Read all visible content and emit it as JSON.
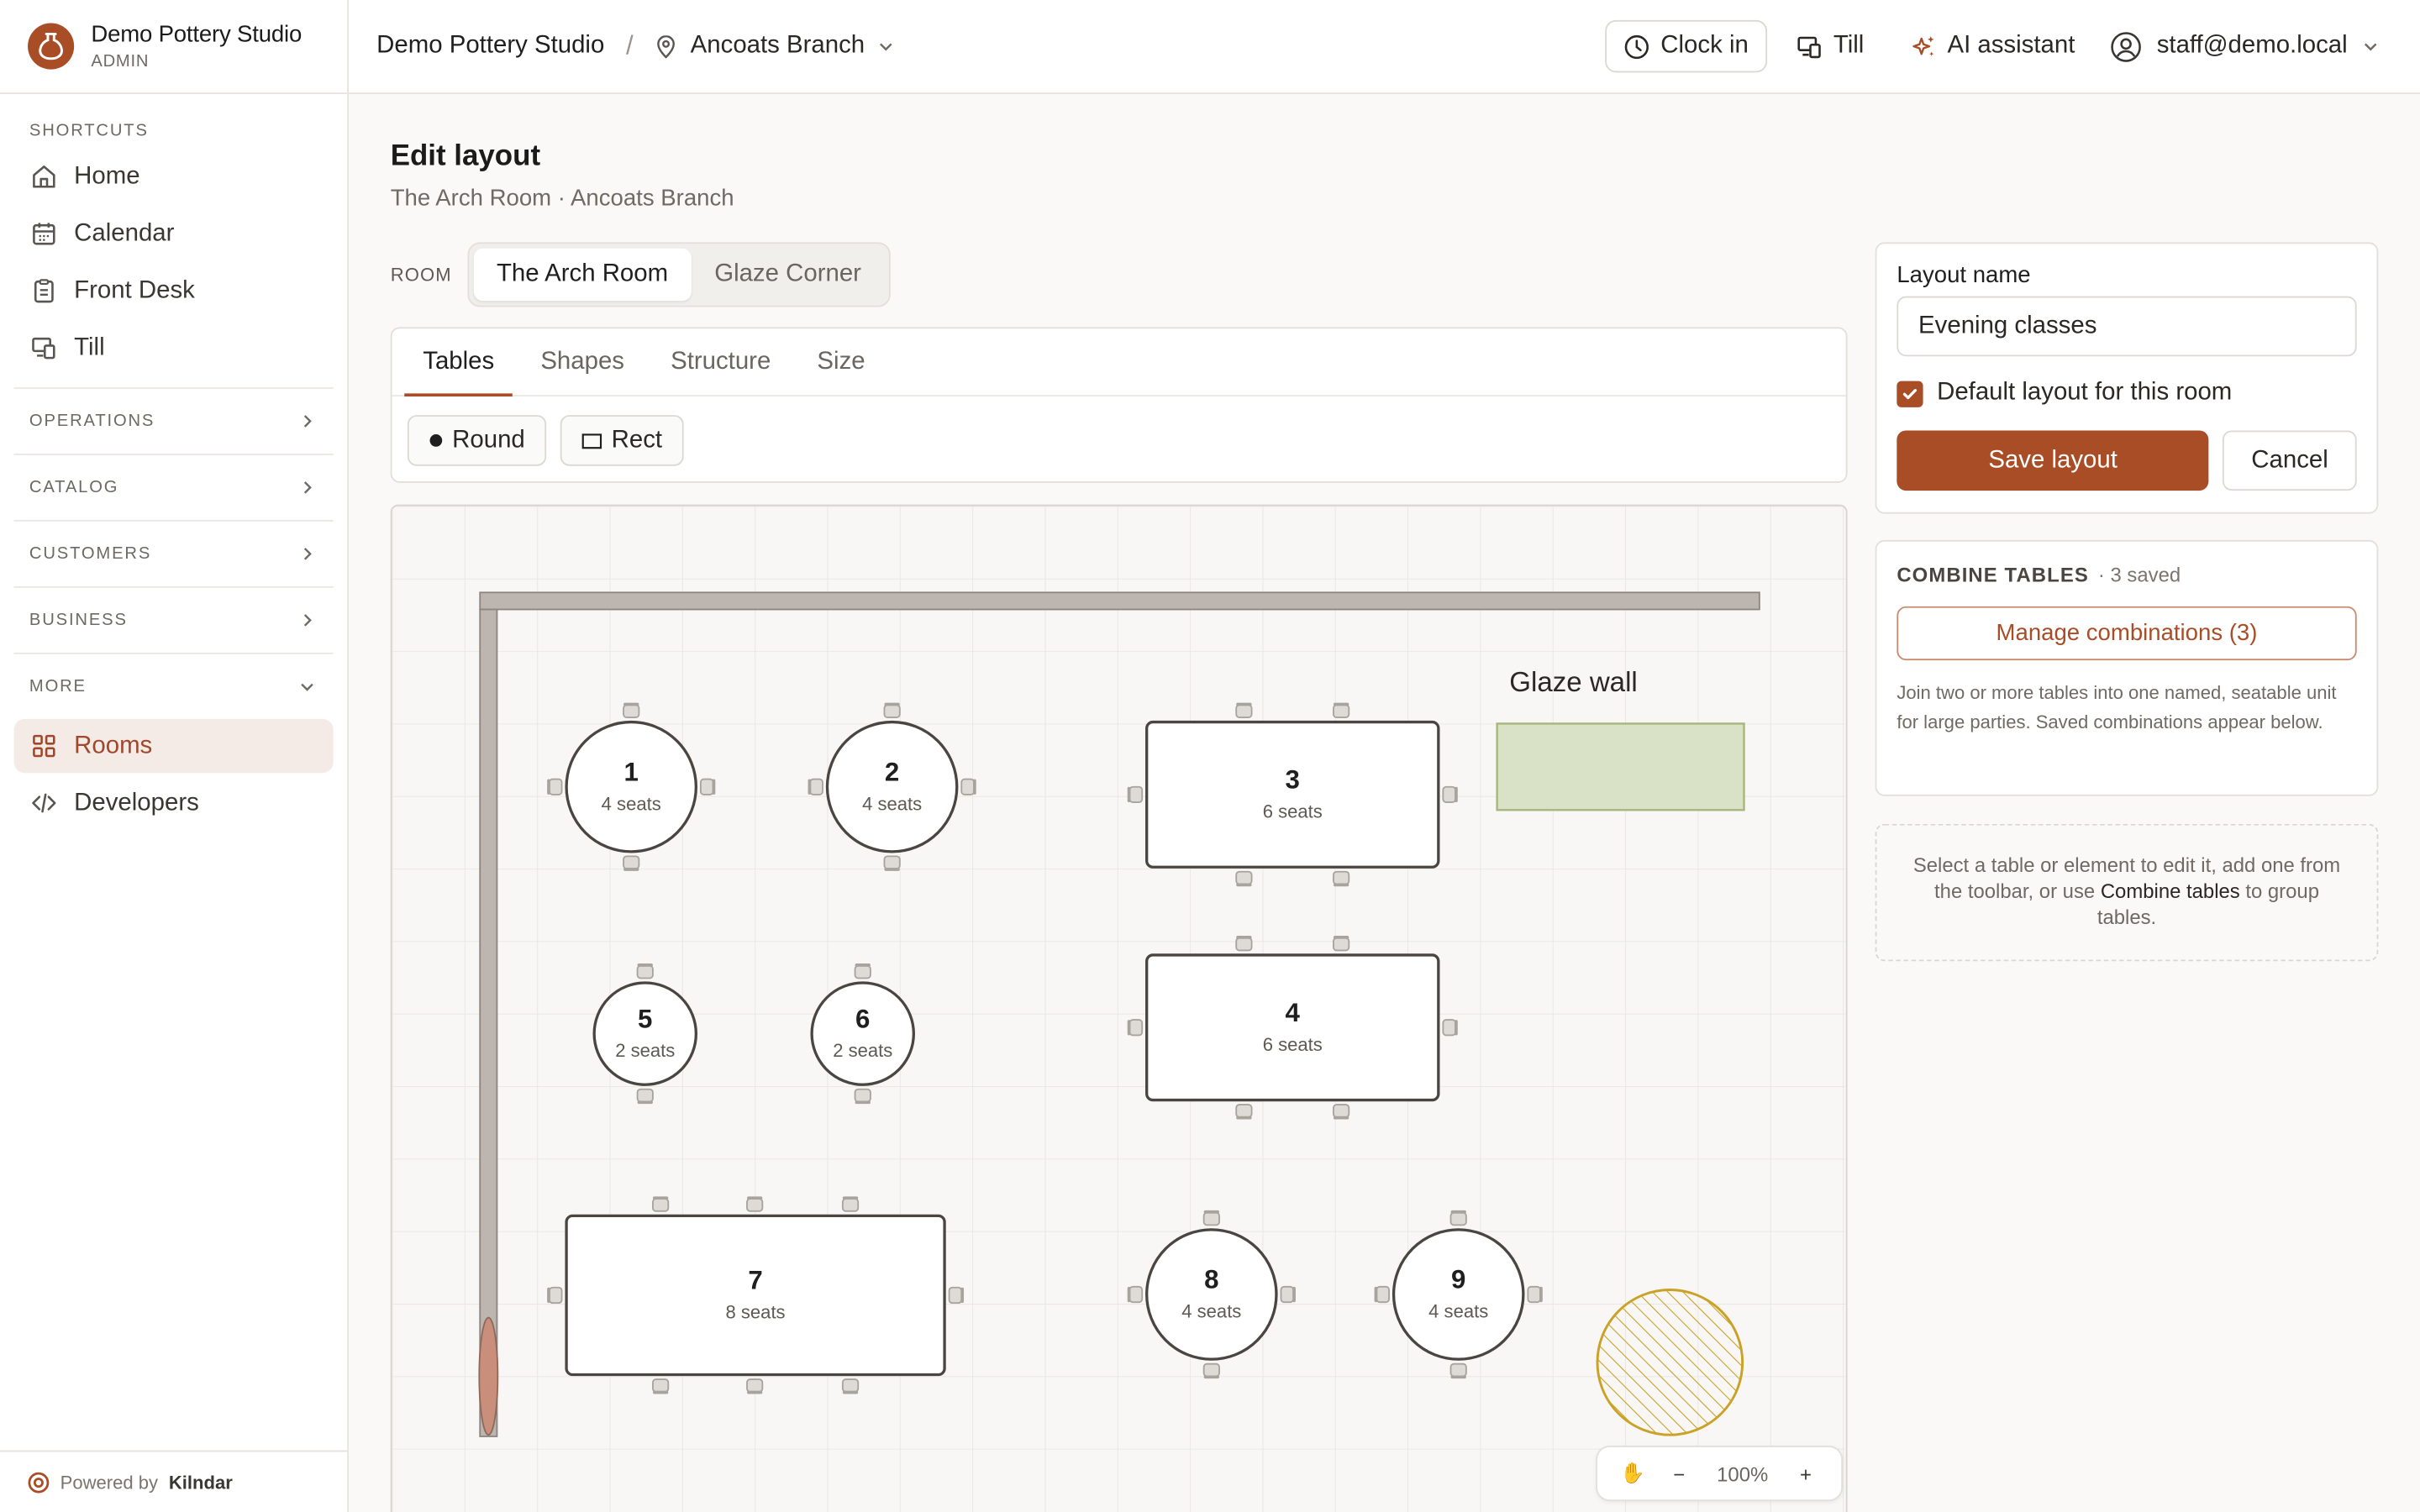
{
  "brand": {
    "name": "Demo Pottery Studio",
    "role": "ADMIN"
  },
  "sidebar": {
    "shortcuts_label": "SHORTCUTS",
    "items": [
      {
        "label": "Home",
        "icon": "home-icon"
      },
      {
        "label": "Calendar",
        "icon": "calendar-icon"
      },
      {
        "label": "Front Desk",
        "icon": "clipboard-icon"
      },
      {
        "label": "Till",
        "icon": "till-icon"
      }
    ],
    "groups": [
      {
        "label": "OPERATIONS"
      },
      {
        "label": "CATALOG"
      },
      {
        "label": "CUSTOMERS"
      },
      {
        "label": "BUSINESS"
      },
      {
        "label": "MORE"
      }
    ],
    "more_items": [
      {
        "label": "Rooms",
        "icon": "grid-icon",
        "active": true
      },
      {
        "label": "Developers",
        "icon": "code-icon"
      }
    ],
    "powered_prefix": "Powered by",
    "powered_brand": "Kilndar"
  },
  "topbar": {
    "studio": "Demo Pottery Studio",
    "separator": "/",
    "branch": "Ancoats Branch",
    "clock_in": "Clock in",
    "till": "Till",
    "ai_assistant": "AI assistant",
    "user": "staff@demo.local"
  },
  "page": {
    "title": "Edit layout",
    "subtitle": "The Arch Room · Ancoats Branch",
    "room_label": "ROOM",
    "rooms": [
      "The Arch Room",
      "Glaze Corner"
    ],
    "active_room": "The Arch Room"
  },
  "toolbar": {
    "tabs": [
      "Tables",
      "Shapes",
      "Structure",
      "Size"
    ],
    "active_tab": "Tables",
    "round_label": "Round",
    "rect_label": "Rect"
  },
  "canvas": {
    "glaze_wall_label": "Glaze wall",
    "glaze_wall_color": "#d9e1c7",
    "tables": [
      {
        "id": "1",
        "seats": "4 seats"
      },
      {
        "id": "2",
        "seats": "4 seats"
      },
      {
        "id": "3",
        "seats": "6 seats"
      },
      {
        "id": "4",
        "seats": "6 seats"
      },
      {
        "id": "5",
        "seats": "2 seats"
      },
      {
        "id": "6",
        "seats": "2 seats"
      },
      {
        "id": "7",
        "seats": "8 seats"
      },
      {
        "id": "8",
        "seats": "4 seats"
      },
      {
        "id": "9",
        "seats": "4 seats"
      }
    ],
    "zoom": "100%",
    "zoom_minus": "−",
    "zoom_plus": "+"
  },
  "layout_form": {
    "name_label": "Layout name",
    "name_value": "Evening classes",
    "default_label": "Default layout for this room",
    "default_checked": true,
    "save_label": "Save layout",
    "cancel_label": "Cancel"
  },
  "combine": {
    "title": "COMBINE TABLES",
    "count": "· 3 saved",
    "manage_label": "Manage combinations (3)",
    "description": "Join two or more tables into one named, seatable unit for large parties. Saved combinations appear below."
  },
  "hint": {
    "before": "Select a table or element to edit it, add one from the toolbar, or use ",
    "bold": "Combine tables",
    "after": " to group tables."
  },
  "colors": {
    "accent": "#a94d27",
    "active_nav_bg": "#f5ebe6"
  }
}
